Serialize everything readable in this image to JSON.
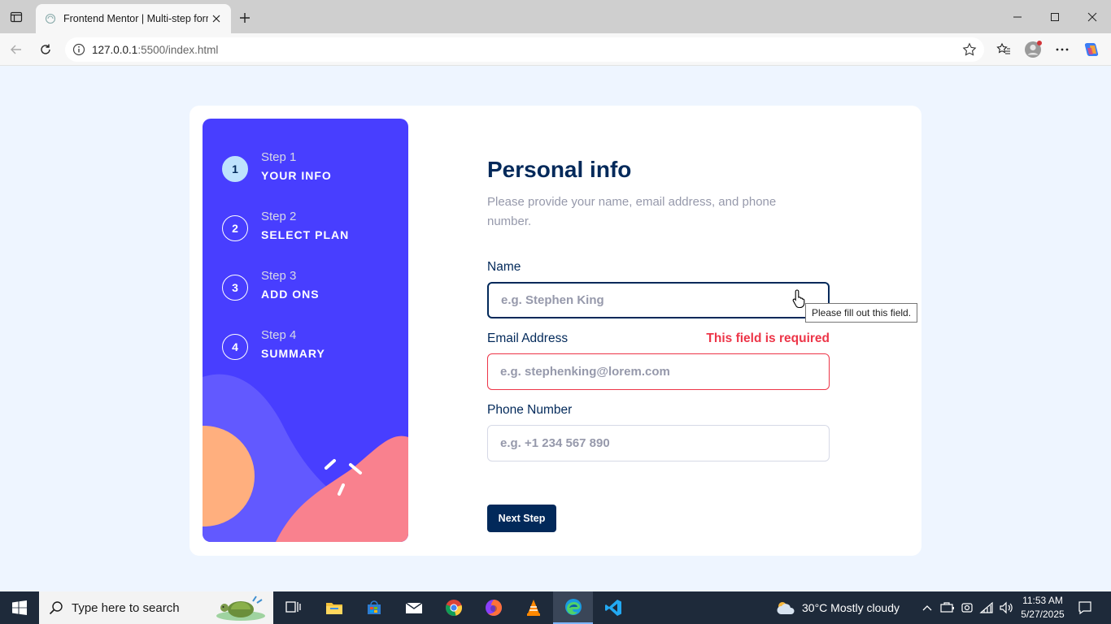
{
  "browser": {
    "tab_title": "Frontend Mentor | Multi-step form",
    "url_host": "127.0.0.1",
    "url_rest": ":5500/index.html"
  },
  "sidebar": {
    "steps": [
      {
        "number": "1",
        "label": "Step 1",
        "title": "YOUR INFO",
        "active": true
      },
      {
        "number": "2",
        "label": "Step 2",
        "title": "SELECT PLAN",
        "active": false
      },
      {
        "number": "3",
        "label": "Step 3",
        "title": "ADD ONS",
        "active": false
      },
      {
        "number": "4",
        "label": "Step 4",
        "title": "SUMMARY",
        "active": false
      }
    ]
  },
  "form": {
    "heading": "Personal info",
    "subheading": "Please provide your name, email address, and phone number.",
    "name": {
      "label": "Name",
      "placeholder": "e.g. Stephen King",
      "value": ""
    },
    "email": {
      "label": "Email Address",
      "placeholder": "e.g. stephenking@lorem.com",
      "value": "",
      "error": "This field is required"
    },
    "phone": {
      "label": "Phone Number",
      "placeholder": "e.g. +1 234 567 890",
      "value": ""
    },
    "next_button": "Next Step",
    "tooltip": "Please fill out this field."
  },
  "taskbar": {
    "search_placeholder": "Type here to search",
    "weather": "30°C  Mostly cloudy",
    "time": "11:53 AM",
    "date": "5/27/2025"
  },
  "colors": {
    "sidebar_bg": "#483eff",
    "primary_text": "#02295a",
    "error": "#ed3548",
    "active_step": "#bee2fd",
    "page_bg": "#eef5ff"
  }
}
